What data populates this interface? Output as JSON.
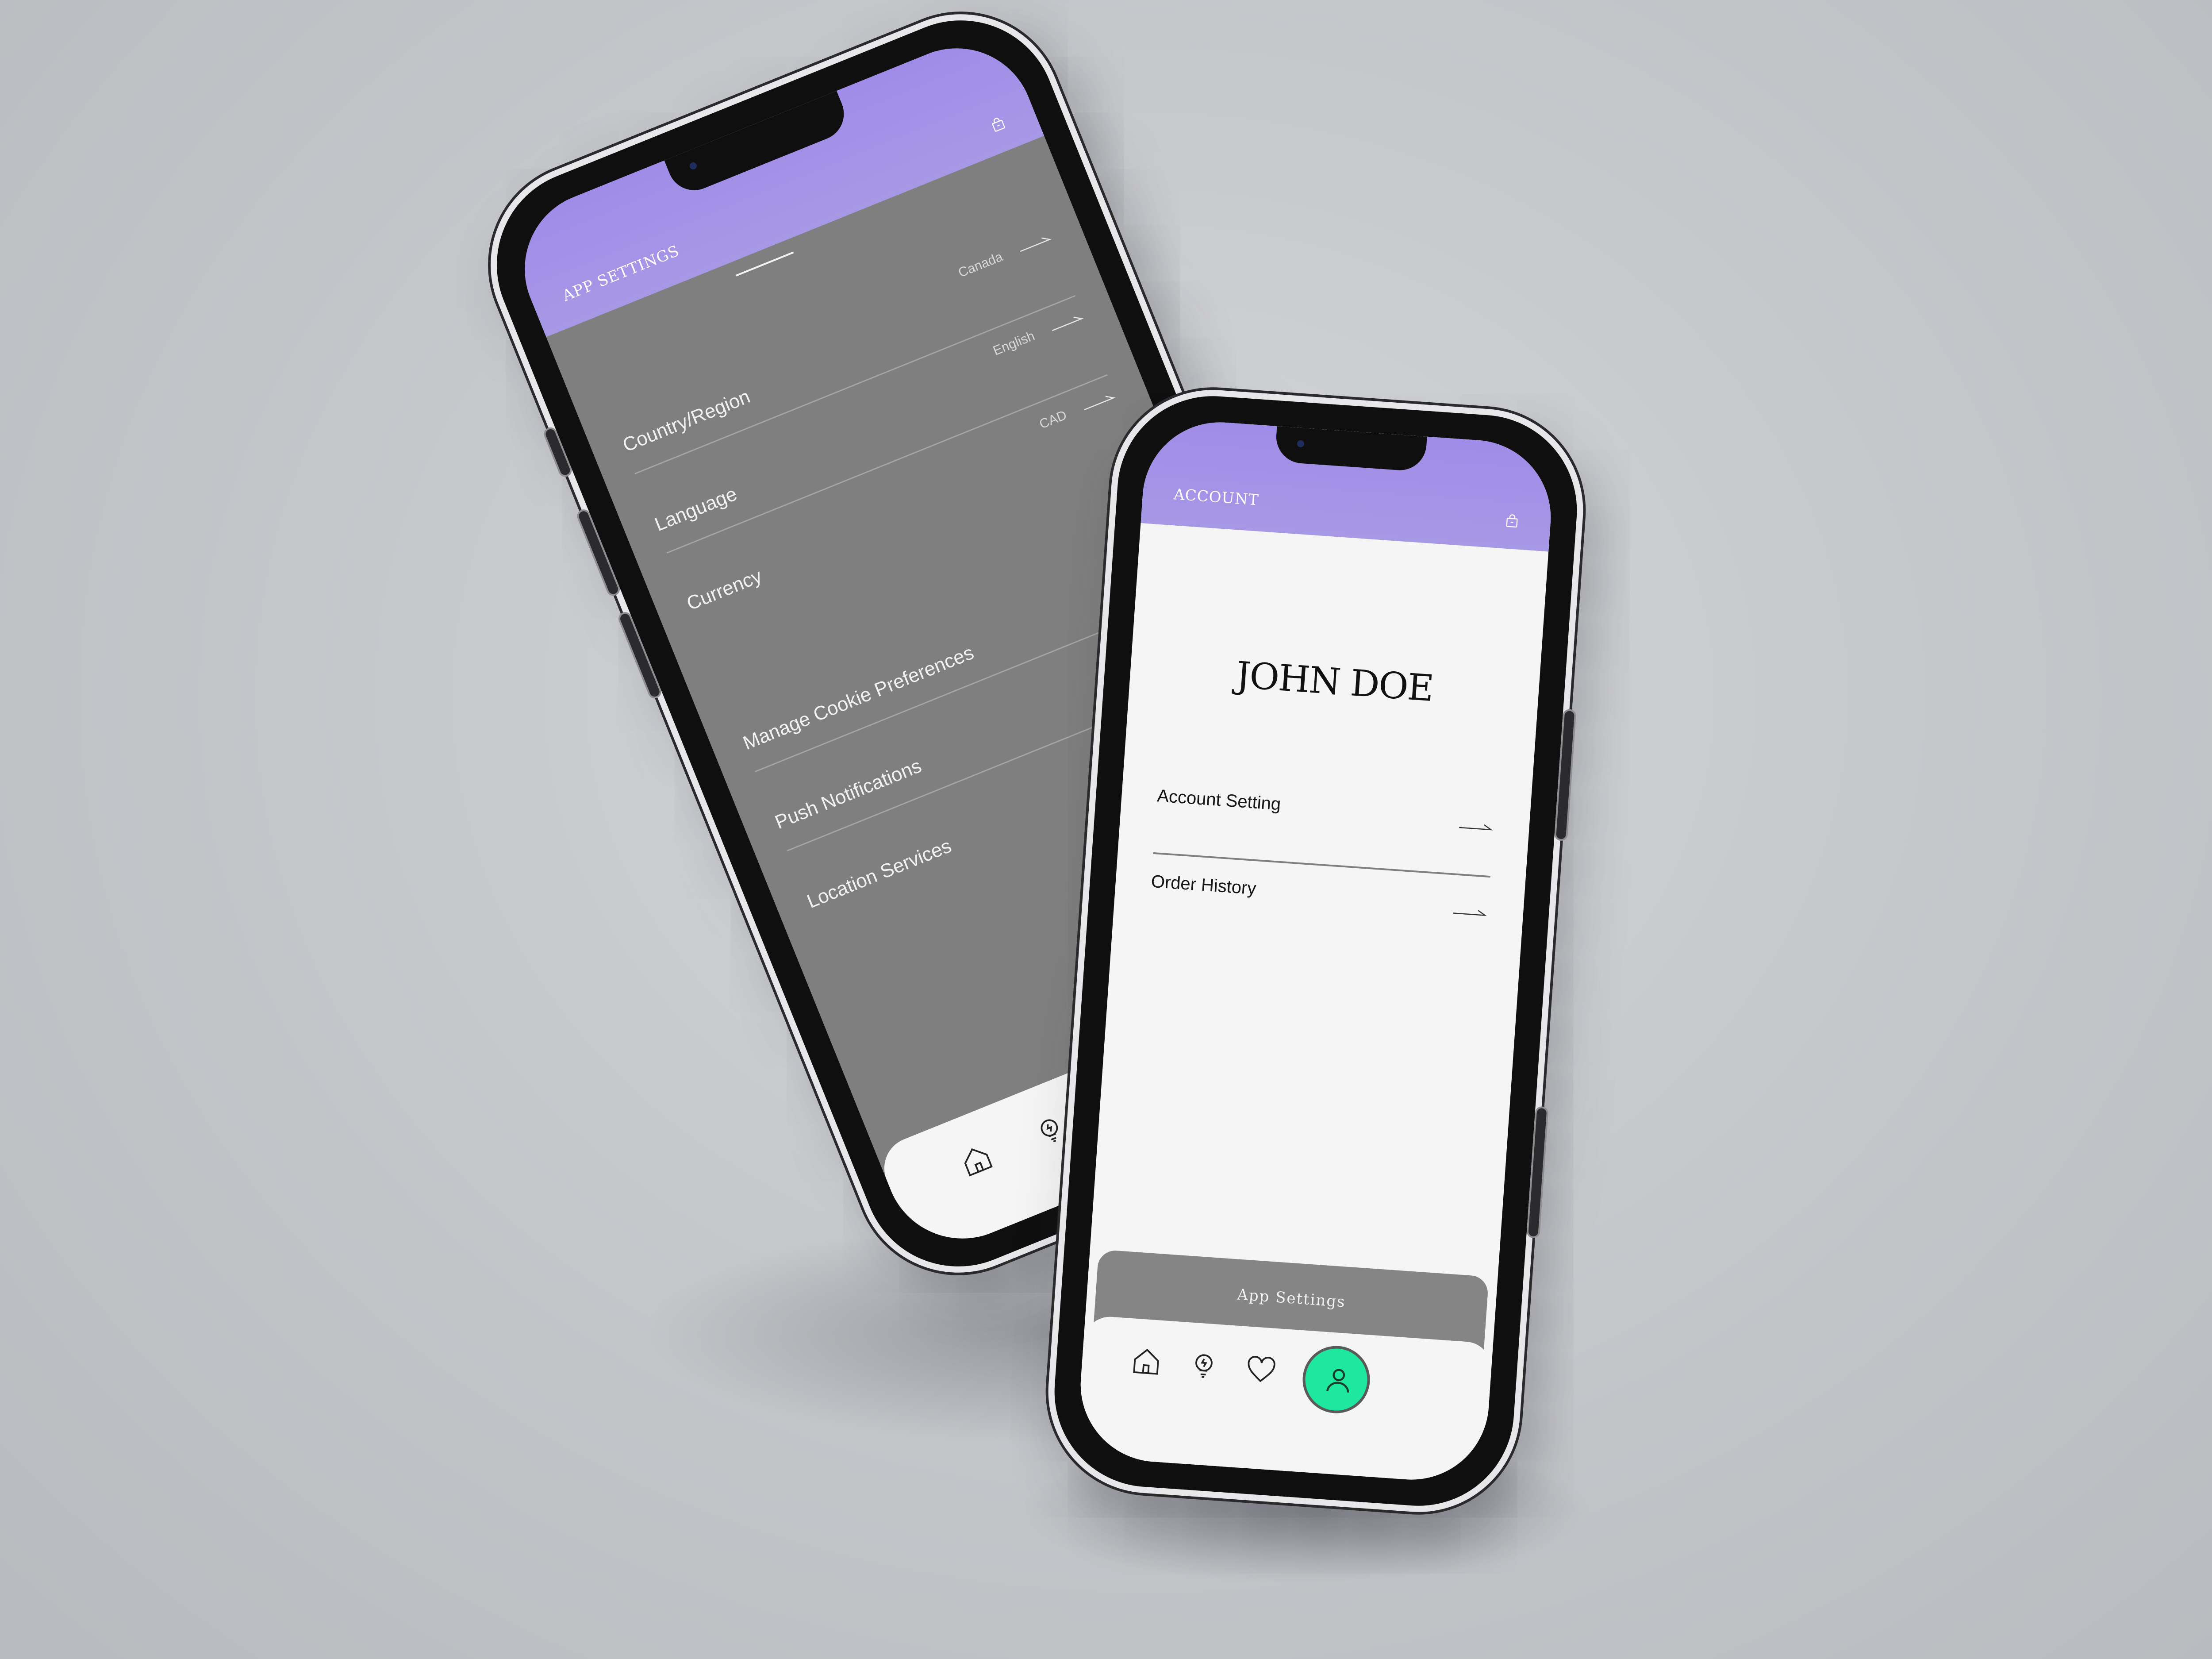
{
  "left_screen": {
    "header_title": "APP SETTINGS",
    "settings": [
      {
        "label": "Country/Region",
        "value": "Canada"
      },
      {
        "label": "Language",
        "value": "English"
      },
      {
        "label": "Currency",
        "value": "CAD"
      },
      {
        "label": "Manage Cookie Preferences",
        "value": ""
      },
      {
        "label": "Push Notifications",
        "value": ""
      },
      {
        "label": "Location Services",
        "value": ""
      }
    ],
    "nav_icons": [
      "home-icon",
      "lightbulb-icon",
      "heart-icon",
      "profile-icon"
    ]
  },
  "right_screen": {
    "header_title": "ACCOUNT",
    "profile_name": "JOHN DOE",
    "menu": [
      {
        "label": "Account Setting"
      },
      {
        "label": "Order History"
      }
    ],
    "bottom_tab_label": "App Settings",
    "nav_icons": [
      "home-icon",
      "lightbulb-icon",
      "heart-icon",
      "profile-icon"
    ]
  },
  "colors": {
    "header_purple": "#a08de8",
    "settings_background": "#7f7f7f",
    "screen_background": "#f5f5f5",
    "active_fab": "#1ee7a0",
    "frame": "#0f0f10"
  }
}
